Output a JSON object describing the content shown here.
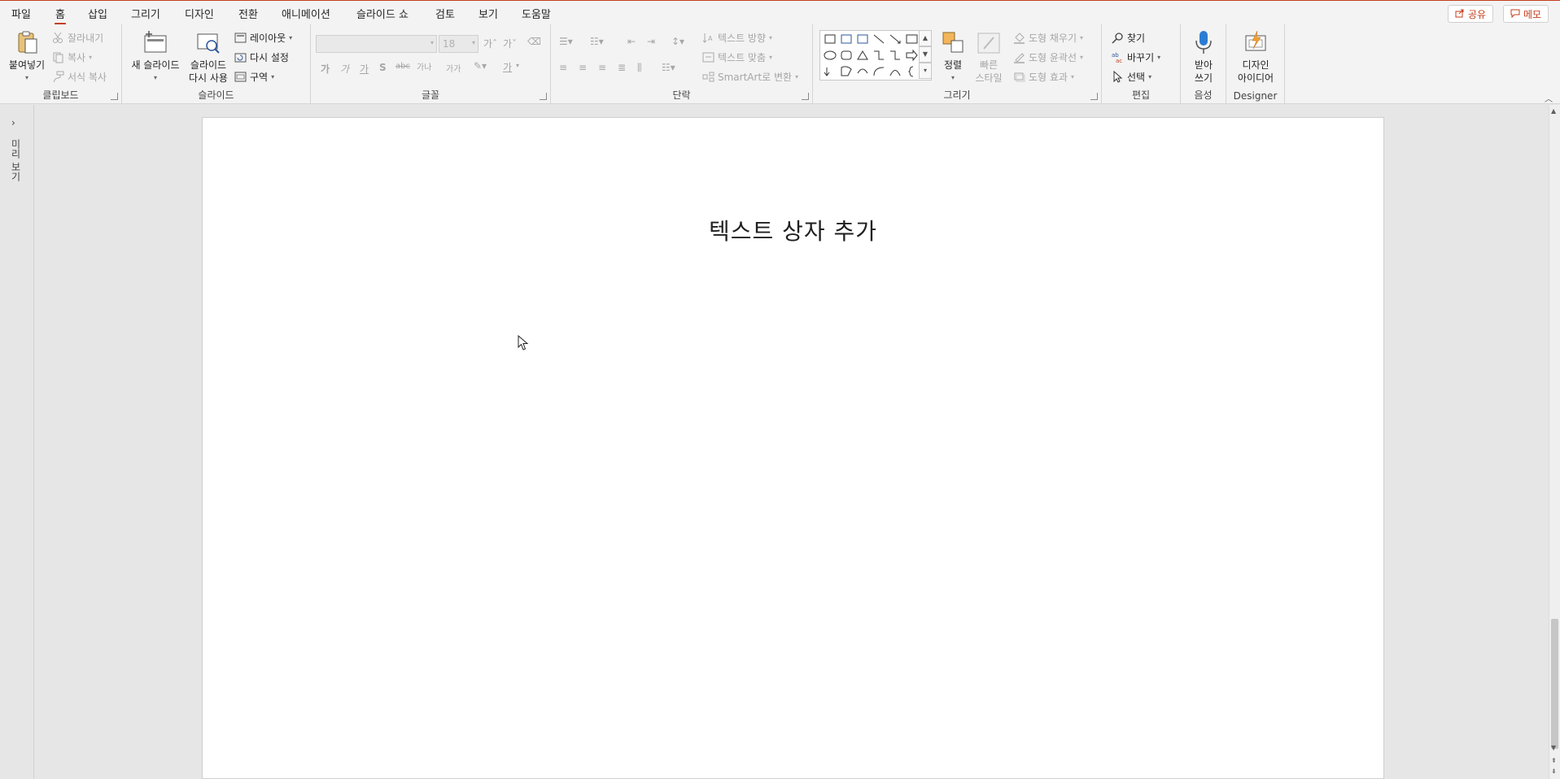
{
  "menu": {
    "tabs": [
      "파일",
      "홈",
      "삽입",
      "그리기",
      "디자인",
      "전환",
      "애니메이션",
      "슬라이드 쇼",
      "검토",
      "보기",
      "도움말"
    ],
    "share_label": "공유",
    "comment_label": "메모"
  },
  "ribbon": {
    "clipboard": {
      "label": "클립보드",
      "paste": "붙여넣기",
      "cut": "잘라내기",
      "copy": "복사",
      "format_painter": "서식 복사"
    },
    "slides": {
      "label": "슬라이드",
      "new_slide": "새 슬라이드",
      "reuse_line1": "슬라이드",
      "reuse_line2": "다시 사용",
      "layout": "레이아웃",
      "reset": "다시 설정",
      "section": "구역"
    },
    "font": {
      "label": "글꼴",
      "font_name": "",
      "font_size": "18",
      "bold": "가",
      "italic": "가",
      "underline": "가",
      "strike": "S",
      "spacing": "가나",
      "case": "가가",
      "color_a": "가"
    },
    "paragraph": {
      "label": "단락",
      "text_direction": "텍스트 방향",
      "align_text": "텍스트 맞춤",
      "smartart": "SmartArt로 변환"
    },
    "drawing": {
      "label": "그리기",
      "arrange": "정렬",
      "quick_styles_1": "빠른",
      "quick_styles_2": "스타일",
      "shape_fill": "도형 채우기",
      "shape_outline": "도형 윤곽선",
      "shape_effects": "도형 효과"
    },
    "editing": {
      "label": "편집",
      "find": "찾기",
      "replace": "바꾸기",
      "select": "선택"
    },
    "voice": {
      "label": "음성",
      "dictate_1": "받아",
      "dictate_2": "쓰기"
    },
    "designer": {
      "label": "Designer",
      "ideas_1": "디자인",
      "ideas_2": "아이디어"
    }
  },
  "leftpane": {
    "label": "미리 보기"
  },
  "slide": {
    "title": "텍스트 상자 추가"
  },
  "colors": {
    "accent": "#c43e1c",
    "ribbon_bg": "#f3f3f3",
    "workspace_bg": "#e6e6e6"
  }
}
